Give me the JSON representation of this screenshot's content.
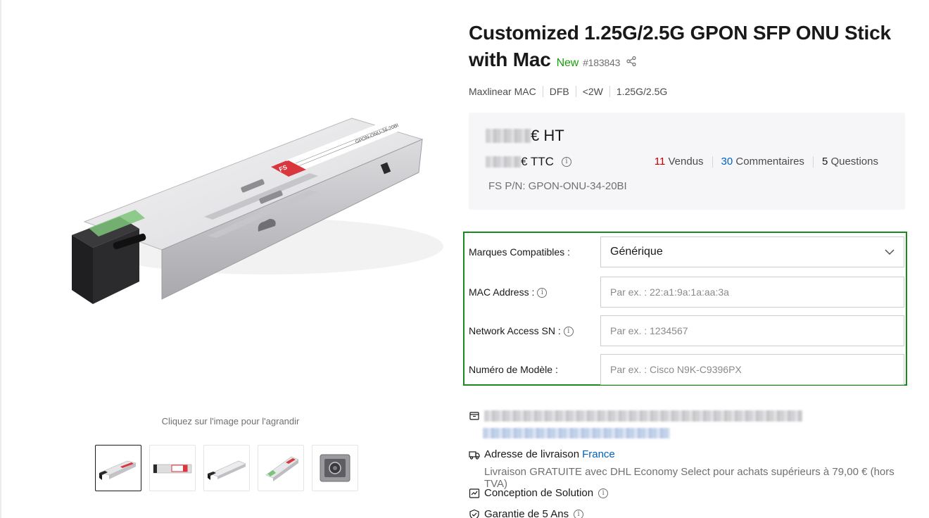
{
  "gallery": {
    "zoom_hint": "Cliquez sur l'image pour l'agrandir",
    "main_image_label_brand": "GPON",
    "main_image_label_model": "GPON-ONU-34-20BI",
    "main_image_label_fs": "FS",
    "thumbnail_count": 5
  },
  "product": {
    "title": "Customized 1.25G/2.5G GPON SFP ONU Stick with Mac",
    "badge": "New",
    "sku": "#183843",
    "tags": [
      "Maxlinear MAC",
      "DFB",
      "<2W",
      "1.25G/2.5G"
    ]
  },
  "price": {
    "ht_suffix": "€ HT",
    "ttc_suffix": "€ TTC",
    "part_number": "FS P/N: GPON-ONU-34-20BI",
    "stats": [
      {
        "count": "11",
        "label": "Vendus"
      },
      {
        "count": "30",
        "label": "Commentaires"
      },
      {
        "count": "5",
        "label": "Questions"
      }
    ]
  },
  "options": {
    "brand_label": "Marques Compatibles :",
    "brand_value": "Générique",
    "mac_label": "MAC Address :",
    "mac_placeholder": "Par ex. : 22:a1:9a:1a:aa:3a",
    "sn_label": "Network Access SN :",
    "sn_placeholder": "Par ex. : 1234567",
    "model_label": "Numéro de Modèle :",
    "model_placeholder": "Par ex. : Cisco N9K-C9396PX"
  },
  "shipping": {
    "address_label": "Adresse de livraison",
    "country": "France",
    "note": "Livraison GRATUITE avec DHL Economy Select pour achats supérieurs à 79,00 € (hors TVA)",
    "solution_label": "Conception de Solution",
    "warranty_label": "Garantie de 5 Ans"
  },
  "colors": {
    "accent_green": "#18a209",
    "highlight_border": "#1a8a1a",
    "link_blue": "#0060bf",
    "sold_red": "#c00000",
    "label_red": "#d9363e"
  },
  "icons": [
    "share-icon",
    "info-icon",
    "chevron-down-icon",
    "package-icon",
    "truck-icon",
    "chart-icon",
    "shield-check-icon"
  ]
}
